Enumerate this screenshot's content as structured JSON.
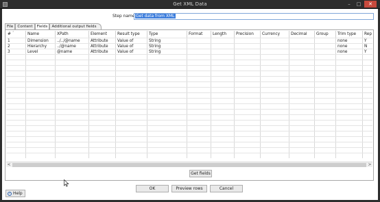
{
  "window": {
    "title": "Get XML Data",
    "minimize_glyph": "–",
    "maximize_glyph": "□",
    "close_glyph": "✕"
  },
  "step": {
    "label": "Step name",
    "value": "Get data from XML"
  },
  "tabs": [
    {
      "label": "File",
      "active": false
    },
    {
      "label": "Content",
      "active": false
    },
    {
      "label": "Fields",
      "active": true
    },
    {
      "label": "Additional output fields",
      "active": false
    }
  ],
  "table": {
    "columns": [
      "#",
      "Name",
      "XPath",
      "Element",
      "Result type",
      "Type",
      "Format",
      "Length",
      "Precision",
      "Currency",
      "Decimal",
      "Group",
      "Trim type",
      "Rep"
    ],
    "rows": [
      [
        "1",
        "Dimension",
        "../../@name",
        "Attribute",
        "Value of",
        "String",
        "",
        "",
        "",
        "",
        "",
        "",
        "none",
        "Y"
      ],
      [
        "2",
        "Hierarchy",
        "../@name",
        "Attribute",
        "Value of",
        "String",
        "",
        "",
        "",
        "",
        "",
        "",
        "none",
        "N"
      ],
      [
        "3",
        "Level",
        "@name",
        "Attribute",
        "Value of",
        "String",
        "",
        "",
        "",
        "",
        "",
        "",
        "none",
        "Y"
      ]
    ]
  },
  "scrollbar": {
    "left_arrow": "<",
    "right_arrow": ">"
  },
  "buttons": {
    "get_fields": "Get fields",
    "ok": "OK",
    "preview": "Preview rows",
    "cancel": "Cancel",
    "help": "Help"
  }
}
